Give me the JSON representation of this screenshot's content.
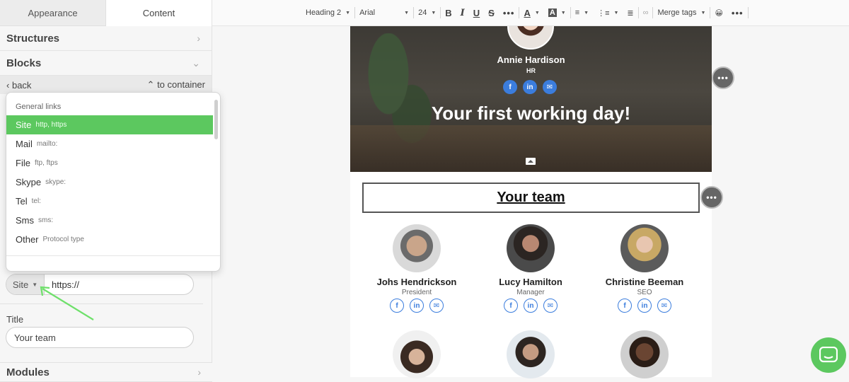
{
  "left_panel": {
    "tabs": [
      {
        "label": "Appearance"
      },
      {
        "label": "Content"
      }
    ],
    "structures_label": "Structures",
    "blocks_label": "Blocks",
    "back_label": "back",
    "to_container_label": "to container",
    "protocol_value": "Site",
    "url_value": "https://",
    "title_label": "Title",
    "title_value": "Your team",
    "modules_label": "Modules"
  },
  "dropdown": {
    "group_label": "General links",
    "items": [
      {
        "label": "Site",
        "hint": "http, https"
      },
      {
        "label": "Mail",
        "hint": "mailto:"
      },
      {
        "label": "File",
        "hint": "ftp, ftps"
      },
      {
        "label": "Skype",
        "hint": "skype:"
      },
      {
        "label": "Tel",
        "hint": "tel:"
      },
      {
        "label": "Sms",
        "hint": "sms:"
      },
      {
        "label": "Other",
        "hint": "Protocol type"
      }
    ],
    "selected_color": "#5cc85f"
  },
  "toolbar": {
    "heading": "Heading 2",
    "font": "Arial",
    "size": "24",
    "bold": "B",
    "italic": "I",
    "underline": "U",
    "strike": "S",
    "more": "•••",
    "text_color": "A",
    "bg_color": "A",
    "merge_tags": "Merge tags",
    "emoji": "😀",
    "more2": "•••"
  },
  "hero": {
    "name": "Annie Hardison",
    "role": "HR",
    "heading": "Your first working day!"
  },
  "team": {
    "title": "Your team",
    "members": [
      {
        "name": "Johs Hendrickson",
        "role": "President"
      },
      {
        "name": "Lucy Hamilton",
        "role": "Manager"
      },
      {
        "name": "Christine Beeman",
        "role": "SEO"
      }
    ]
  },
  "social": {
    "facebook": "f",
    "linkedin": "in",
    "email": "✉"
  },
  "colors": {
    "accent": "#5cc85f",
    "social": "#3b7ddd"
  }
}
